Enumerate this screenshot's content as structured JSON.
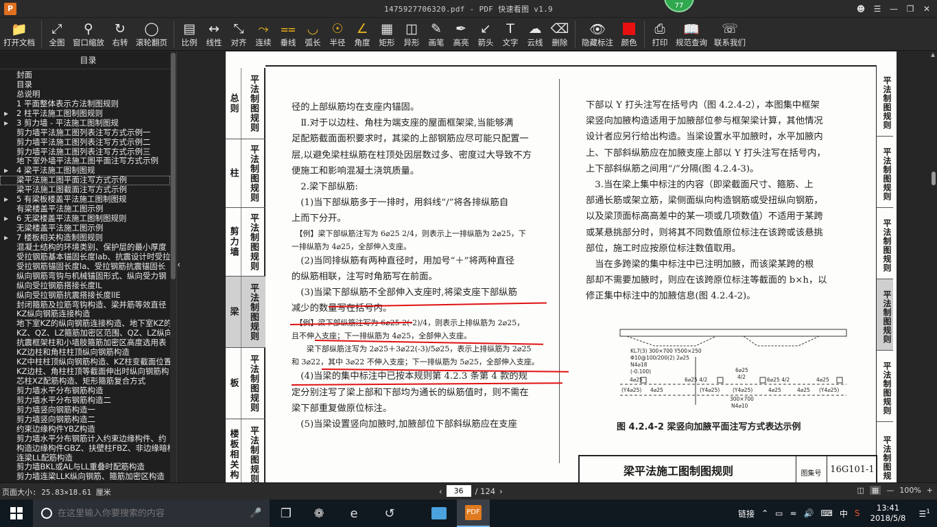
{
  "window": {
    "title": "1475927706320.pdf - PDF 快速看图 v1.9",
    "badge": "77",
    "logo": "P"
  },
  "toolbar": [
    {
      "name": "open-file",
      "label": "打开文档",
      "icon": "folder-icon"
    },
    {
      "name": "fit-page",
      "label": "全图",
      "icon": "fullscreen-icon"
    },
    {
      "name": "window-zoom",
      "label": "窗口缩放",
      "icon": "magnifier-icon"
    },
    {
      "name": "rotate-right",
      "label": "右转",
      "icon": "rotate-icon"
    },
    {
      "name": "scroll-page",
      "label": "滚轮翻页",
      "icon": "mouse-icon"
    },
    {
      "name": "scale",
      "label": "比例",
      "icon": "ruler-icon"
    },
    {
      "name": "linear",
      "label": "线性",
      "icon": "linear-measure-icon"
    },
    {
      "name": "align",
      "label": "对齐",
      "icon": "align-measure-icon"
    },
    {
      "name": "continuous",
      "label": "连续",
      "icon": "polyline-icon"
    },
    {
      "name": "perpendicular",
      "label": "垂线",
      "icon": "perpendicular-icon"
    },
    {
      "name": "arc-length",
      "label": "弧长",
      "icon": "arc-icon"
    },
    {
      "name": "radius",
      "label": "半径",
      "icon": "radius-icon"
    },
    {
      "name": "angle",
      "label": "角度",
      "icon": "angle-icon"
    },
    {
      "name": "rectangle",
      "label": "矩形",
      "icon": "rectangle-area-icon"
    },
    {
      "name": "irregular",
      "label": "异形",
      "icon": "irregular-area-icon"
    },
    {
      "name": "pen",
      "label": "画笔",
      "icon": "pen-icon"
    },
    {
      "name": "highlight",
      "label": "高亮",
      "icon": "highlighter-icon"
    },
    {
      "name": "arrow",
      "label": "箭头",
      "icon": "arrow-icon"
    },
    {
      "name": "text",
      "label": "文字",
      "icon": "text-icon"
    },
    {
      "name": "cloud-line",
      "label": "云线",
      "icon": "cloud-icon"
    },
    {
      "name": "delete",
      "label": "删除",
      "icon": "eraser-icon"
    },
    {
      "name": "hide-marks",
      "label": "隐藏标注",
      "icon": "eye-hidden-icon"
    },
    {
      "name": "color",
      "label": "颜色",
      "icon": "color-swatch-icon"
    },
    {
      "name": "print",
      "label": "打印",
      "icon": "printer-icon"
    },
    {
      "name": "spec-query",
      "label": "规范查询",
      "icon": "book-icon"
    },
    {
      "name": "contact",
      "label": "联系我们",
      "icon": "support-icon"
    }
  ],
  "accent_color": "#e01010",
  "toc": {
    "title": "目录",
    "items": [
      {
        "label": "封面",
        "arrow": false
      },
      {
        "label": "目录",
        "arrow": false
      },
      {
        "label": "总说明",
        "arrow": false
      },
      {
        "label": "1 平面整体表示方法制图规则",
        "arrow": false
      },
      {
        "label": "2 柱平法施工图制图规则",
        "arrow": true
      },
      {
        "label": "3 剪力墙 - 平法施工图制图规",
        "arrow": true
      },
      {
        "label": "剪力墙平法施工图列表注写方式示例一",
        "arrow": false
      },
      {
        "label": "剪力墙平法施工图列表注写方式示例二",
        "arrow": false
      },
      {
        "label": "剪力墙平法施工图列表注写方式示例三",
        "arrow": false
      },
      {
        "label": "地下室外墙平法施工图平面注写方式示例",
        "arrow": false
      },
      {
        "label": "4 梁平法施工图制图规",
        "arrow": true
      },
      {
        "label": "梁平法施工图平面注写方式示例",
        "arrow": false,
        "selected": true
      },
      {
        "label": "梁平法施工图截面注写方式示例",
        "arrow": false
      },
      {
        "label": "5 有梁板楼盖平法施工图制图规",
        "arrow": true
      },
      {
        "label": "有梁楼盖平法施工图示例",
        "arrow": false
      },
      {
        "label": "6 无梁楼盖平法施工图制图规则",
        "arrow": true
      },
      {
        "label": "无梁楼盖平法施工图示例",
        "arrow": false
      },
      {
        "label": "7 楼板相关构造制图规则",
        "arrow": true
      },
      {
        "label": "混凝土结构的环境类别、保护层的最小厚度",
        "arrow": false
      },
      {
        "label": "受拉钢筋基本锚固长度lab、抗震设计时受拉",
        "arrow": false
      },
      {
        "label": "受拉钢筋锚固长度la、受拉钢筋抗震锚固长",
        "arrow": false
      },
      {
        "label": "纵向钢筋弯钩与机械锚固形式、纵向受力钢",
        "arrow": false
      },
      {
        "label": "纵向受拉钢筋搭接长度lL",
        "arrow": false
      },
      {
        "label": "纵向受拉钢筋抗震搭接长度llE",
        "arrow": false
      },
      {
        "label": "封闭箍筋及拉筋弯钩构造、梁并筋等效直径",
        "arrow": false
      },
      {
        "label": "KZ纵向钢筋连接构造",
        "arrow": false
      },
      {
        "label": "地下室KZ的纵向钢筋连接构造、地下室KZ的",
        "arrow": false
      },
      {
        "label": "KZ、QZ、LZ箍筋加密区范围、QZ、LZ纵向钢",
        "arrow": false
      },
      {
        "label": "抗震框架柱和小墙肢箍筋加密区高度选用表",
        "arrow": false
      },
      {
        "label": "KZ边柱和角柱柱顶纵向钢筋构造",
        "arrow": false
      },
      {
        "label": "KZ中柱柱顶纵向钢筋构造、KZ柱变截面位置",
        "arrow": false
      },
      {
        "label": "KZ边柱、角柱柱顶等截面伸出时纵向钢筋构",
        "arrow": false
      },
      {
        "label": "芯柱XZ配筋构造、矩形箍筋复合方式",
        "arrow": false
      },
      {
        "label": "剪力墙水平分布钢筋构造",
        "arrow": false
      },
      {
        "label": "剪力墙水平分布钢筋构造二",
        "arrow": false
      },
      {
        "label": "剪力墙竖向钢筋构造一",
        "arrow": false
      },
      {
        "label": "剪力墙竖向钢筋构造二",
        "arrow": false
      },
      {
        "label": "约束边缘构件YBZ构造",
        "arrow": false
      },
      {
        "label": "剪力墙水平分布钢筋计入约束边缘构件、约",
        "arrow": false
      },
      {
        "label": "构造边缘构件GBZ、扶壁柱FBZ、非边缘暗柱",
        "arrow": false
      },
      {
        "label": "连梁LL配筋构造",
        "arrow": false
      },
      {
        "label": "剪力墙BKL或AL与LL重叠时配筋构造",
        "arrow": false
      },
      {
        "label": "剪力墙连梁LLK纵向钢筋、箍筋加密区构造",
        "arrow": false
      }
    ]
  },
  "page": {
    "left_tabs": [
      {
        "a": "总则",
        "b": "平法制图规则"
      },
      {
        "a": "柱",
        "b": "平法制图规则"
      },
      {
        "a": "剪力墙",
        "b": "平法制图规则"
      },
      {
        "a": "梁",
        "b": "平法制图规则",
        "active": true
      },
      {
        "a": "板",
        "b": "平法制图规则"
      },
      {
        "a": "楼板相关构",
        "b": "平法制图规则"
      }
    ],
    "right_tabs": [
      {
        "label": "平法制图规则"
      },
      {
        "label": "平法制图规则"
      },
      {
        "label": "平法制图规则"
      },
      {
        "label": "平法制图规则",
        "active": true
      },
      {
        "label": "平法制图规则"
      },
      {
        "label": "平法制图规"
      }
    ],
    "col1": [
      {
        "t": "径的上部纵筋均在支座内锚固。"
      },
      {
        "t": "　Ⅱ.对于以边柱、角柱为端支座的屋面框架梁,当能够满"
      },
      {
        "t": "足配筋截面面积要求时，其梁的上部钢筋应尽可能只配置一"
      },
      {
        "t": "层,以避免梁柱纵筋在柱顶处因层数过多、密度过大导致不方"
      },
      {
        "t": "便施工和影响混凝土浇筑质量。"
      },
      {
        "t": "　2.梁下部纵筋:"
      },
      {
        "t": "　(1)当下部纵筋多于一排时，用斜线“/”将各排纵筋自"
      },
      {
        "t": "上而下分开。"
      },
      {
        "t": "　【例】梁下部纵筋注写为 6⌀25 2/4，则表示上一排纵筋为 2⌀25，下",
        "s": 1
      },
      {
        "t": "一排纵筋为 4⌀25，全部伸入支座。",
        "s": 1
      },
      {
        "t": "　(2)当同排纵筋有两种直径时，用加号“＋”将两种直径"
      },
      {
        "t": "的纵筋相联，注写时角筋写在前面。"
      },
      {
        "t": "　(3)当梁下部纵筋不全部伸入支座时,将梁支座下部纵筋"
      },
      {
        "t": "减少的数量写在括号内。"
      },
      {
        "t": "　【例】梁下部纵筋注写为 6⌀25 2(-2)/4，则表示上排纵筋为 2⌀25，",
        "s": 1
      },
      {
        "t": "且不伸入支座；下一排纵筋为 4⌀25，全部伸入支座。",
        "s": 1
      },
      {
        "t": "　　梁下部纵筋注写为 2⌀25＋3⌀22(-3)/5⌀25，表示上排纵筋为 2⌀25",
        "s": 1
      },
      {
        "t": "和 3⌀22，其中 3⌀22 不伸入支座；下一排纵筋为 5⌀25，全部伸入支座。",
        "s": 1
      },
      {
        "t": "　(4)当梁的集中标注中已按本规则第 4.2.3 条第 4 款的规"
      },
      {
        "t": "定分别注写了梁上部和下部均为通长的纵筋值时，则不需在"
      },
      {
        "t": "梁下部重复做原位标注。"
      },
      {
        "t": "　(5)当梁设置竖向加腋时,加腋部位下部斜纵筋应在支座"
      }
    ],
    "col2": [
      "下部以 Y 打头注写在括号内（图 4.2.4-2），本图集中框架",
      "梁竖向加腋构造适用于加腋部位参与框架梁计算，其他情况",
      "设计者应另行给出构造。当梁设置水平加腋时，水平加腋内",
      "上、下部斜纵筋应在加腋支座上部以 Y 打头注写在括号内，",
      "上下部斜纵筋之间用“/”分隔(图 4.2.4-3)。",
      "　3.当在梁上集中标注的内容（即梁截面尺寸、箍筋、上",
      "部通长筋或架立筋，梁侧面纵向构造钢筋或受扭纵向钢筋，",
      "以及梁顶面标高高差中的某一项或几项数值）不适用于某跨",
      "或某悬挑部分时，则将其不同数值原位标注在该跨或该悬挑",
      "部位，施工时应按原位标注数值取用。",
      "　当在多跨梁的集中标注中已注明加腋，而该梁某跨的根",
      "部却不需要加腋时，则应在该跨原位标注等截面的 b×h，以",
      "修正集中标注中的加腋信息(图 4.2.4-2)。"
    ],
    "figure": {
      "caption": "图 4.2.4-2 梁竖向加腋平面注写方式表达示例",
      "labels": {
        "kl": "KL7(3) 300×700 Y500×250",
        "stir": "Φ10@100/200(2) 2⌀25",
        "n": "N4⌀18",
        "el": "(-0.100)",
        "a1": "4⌀25",
        "a2": "6⌀25 4/2",
        "a3": "6⌀25",
        "a4": "4/2",
        "a5": "6⌀25 4/2",
        "a6": "4⌀25",
        "b1": "(Y4⌀25)",
        "b2": "4⌀25",
        "b3": "(Y4⌀25)",
        "b4": "4⌀25",
        "b5": "(Y4⌀25)",
        "b6": "4⌀25",
        "b7": "(Y4⌀25)",
        "mid1": "300×700",
        "mid2": "N4⌀10"
      }
    },
    "footer": {
      "title": "梁平法施工图制图规则",
      "label": "图集号",
      "value": "16G101-1"
    }
  },
  "status": {
    "page_size": "页面大小: 25.83×18.61 厘米",
    "current_page": "36",
    "total_pages": "/ 124",
    "zoom": "100%"
  },
  "taskbar": {
    "search_placeholder": "在这里输入你要搜索的内容",
    "link_label": "链接",
    "ime": "中",
    "time": "13:41",
    "date": "2018/5/8",
    "notifications": "1"
  }
}
